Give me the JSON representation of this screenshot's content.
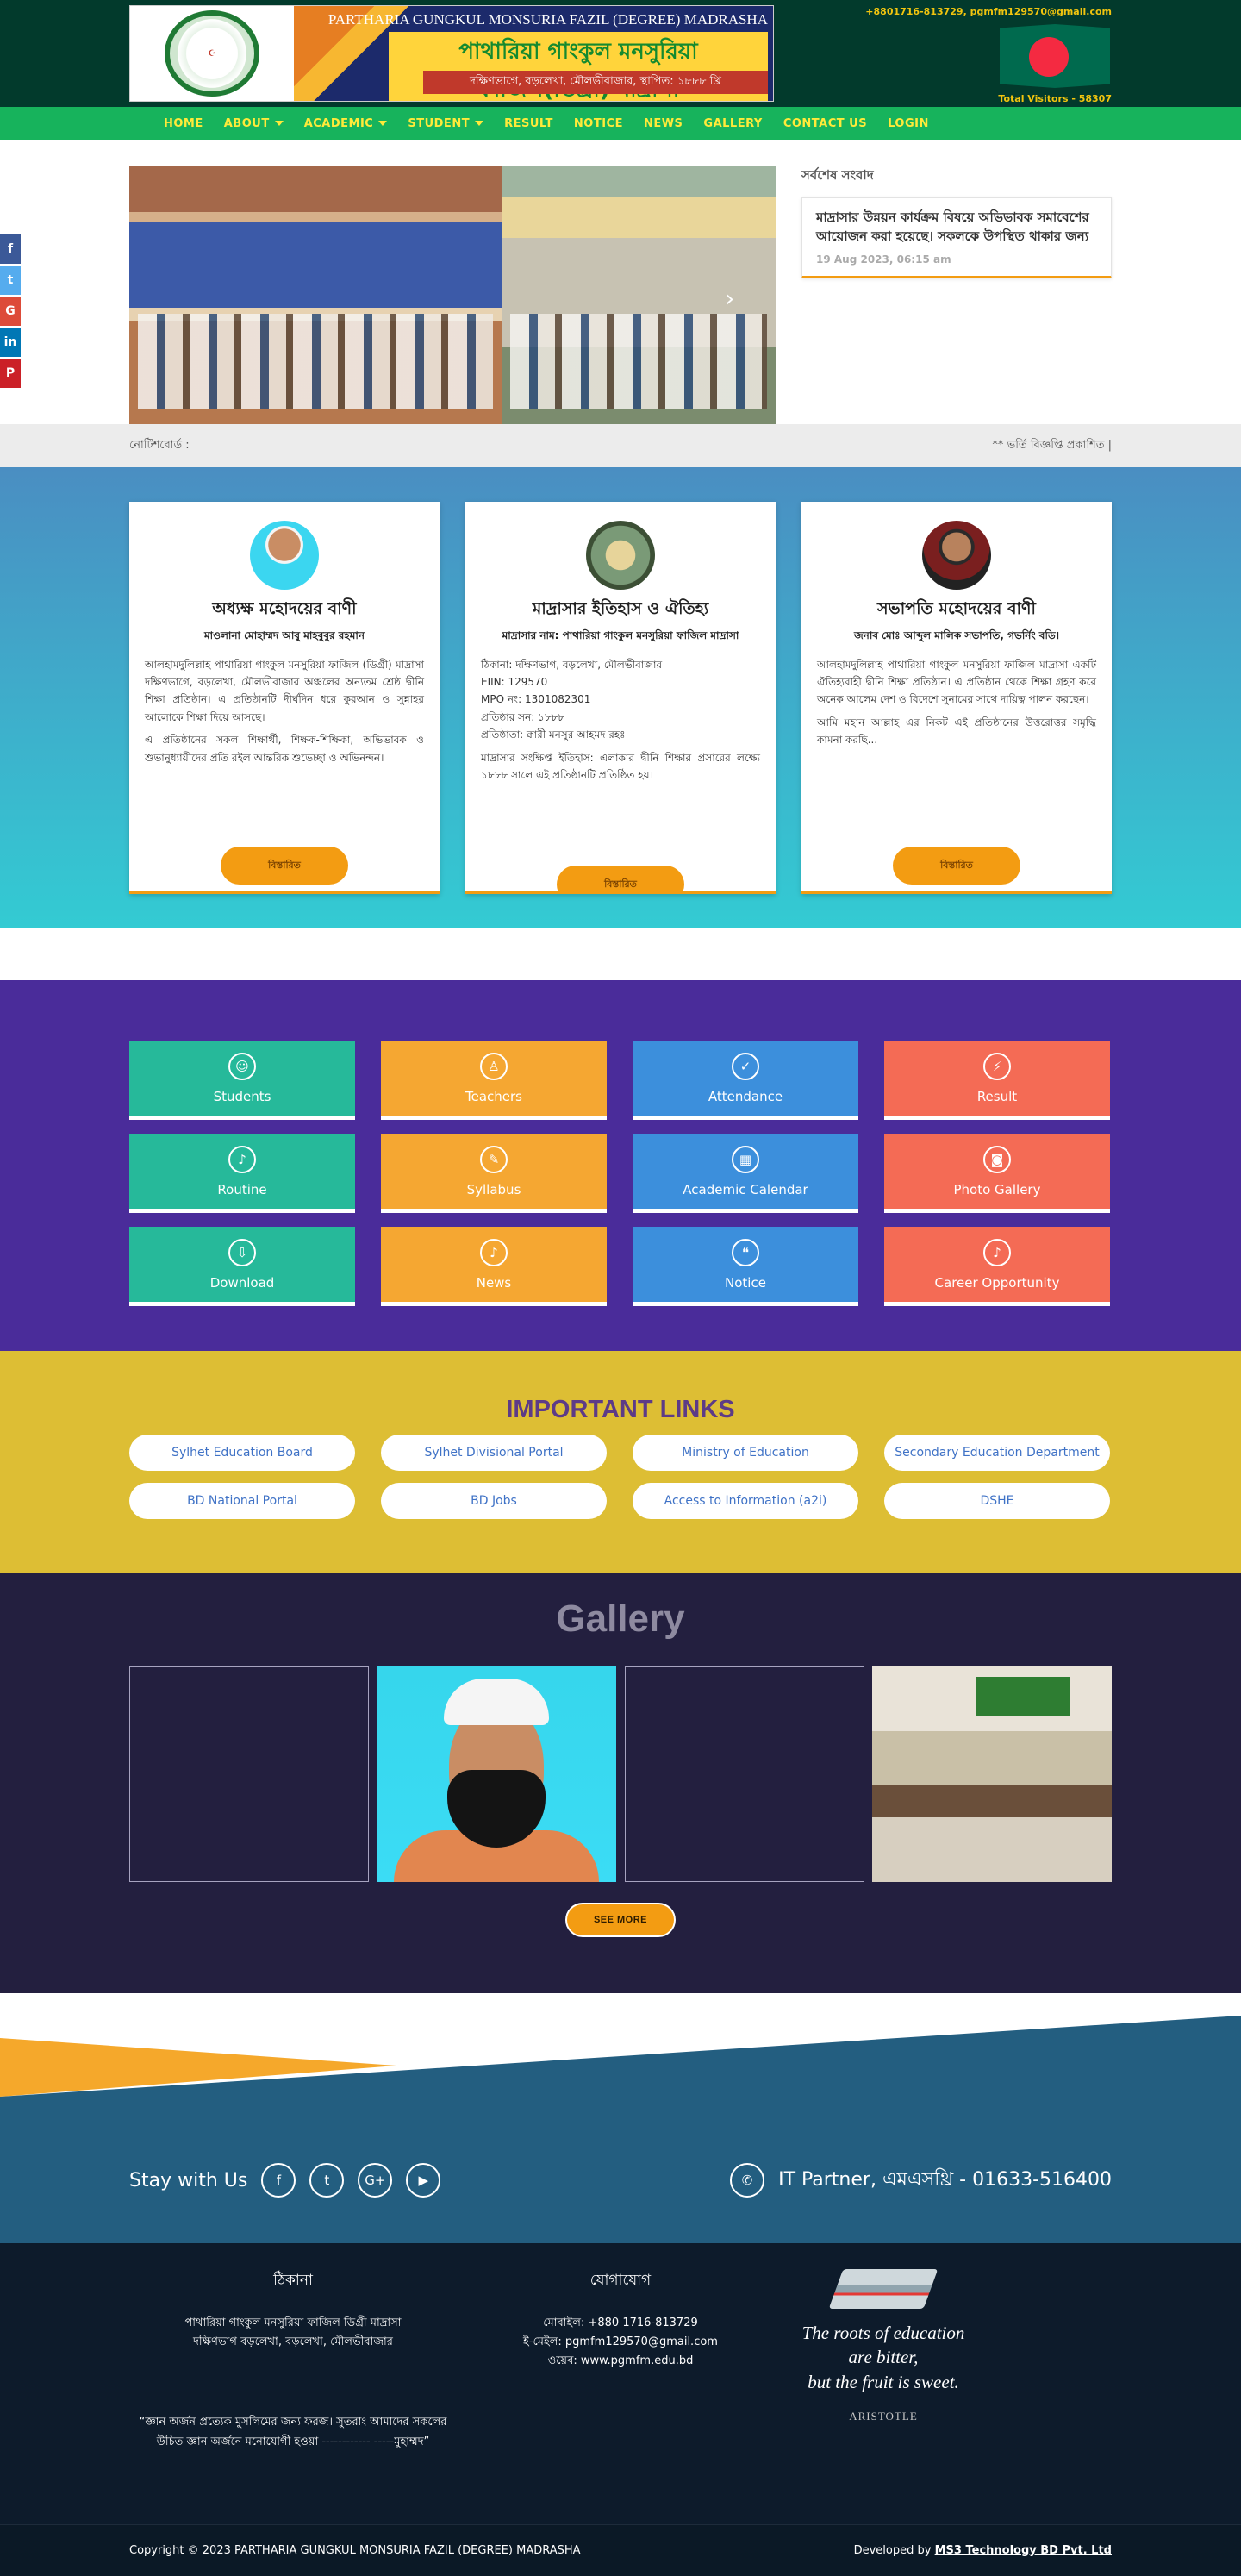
{
  "header": {
    "school_name_en": "PARTHARIA GUNGKUL MONSURIA FAZIL (DEGREE) MADRASHA",
    "school_name_bn": "পাথারিয়া গাংকুল মনসুরিয়া ফাজিল(ডিগ্রী) মাদ্রাসা",
    "address_bn": "দক্ষিণভাগে, বড়লেখা, মৌলভীবাজার, স্থাপিত: ১৮৮৮ খ্রি",
    "contact": "+8801716-813729, pgmfm129570@gmail.com",
    "visitors": "Total Visitors - 58307",
    "colors": {
      "header_bg": "#023a2c",
      "nav_bg": "#17b35c",
      "nav_text": "#ffea3a"
    }
  },
  "nav": [
    {
      "label": "HOME",
      "dropdown": false
    },
    {
      "label": "ABOUT",
      "dropdown": true
    },
    {
      "label": "ACADEMIC",
      "dropdown": true
    },
    {
      "label": "STUDENT",
      "dropdown": true
    },
    {
      "label": "RESULT",
      "dropdown": false
    },
    {
      "label": "NOTICE",
      "dropdown": false
    },
    {
      "label": "NEWS",
      "dropdown": false
    },
    {
      "label": "GALLERY",
      "dropdown": false
    },
    {
      "label": "CONTACT US",
      "dropdown": false
    },
    {
      "label": "LOGIN",
      "dropdown": false
    }
  ],
  "social_float": [
    "f",
    "t",
    "G",
    "in",
    "P"
  ],
  "latest_news": {
    "heading": "সর্বশেষ সংবাদ",
    "text": "মাদ্রাসার উন্নয়ন কার্যক্রম বিষয়ে অভিভাবক সমাবেশের আয়োজন করা হয়েছে। সকলকে উপস্থিত থাকার জন্য",
    "date": "19 Aug 2023, 06:15 am"
  },
  "ticker": {
    "label": "নোটিশবোর্ড :",
    "text": "** ভর্তি বিজ্ঞপ্তি প্রকাশিত |"
  },
  "profiles": [
    {
      "title": "অধ্যক্ষ মহোদয়ের বাণী",
      "subtitle": "মাওলানা মোহাম্মদ আবু মাহবুবুর রহমান",
      "body1": "আলহামদুলিল্লাহ পাথারিয়া গাংকুল মনসুরিয়া ফাজিল (ডিগ্রী) মাদ্রাসা দক্ষিণভাগে, বড়লেখা, মৌলভীবাজার অঞ্চলের অন্যতম শ্রেষ্ঠ দ্বীনি শিক্ষা প্রতিষ্ঠান। এ প্রতিষ্ঠানটি দীর্ঘদিন ধরে কুরআন ও সুন্নাহর আলোকে শিক্ষা দিয়ে আসছে।",
      "body2": "এ প্রতিষ্ঠানের সকল শিক্ষার্থী, শিক্ষক-শিক্ষিকা, অভিভাবক ও শুভানুধ্যায়ীদের প্রতি রইল আন্তরিক শুভেচ্ছা ও অভিনন্দন।",
      "button": "বিস্তারিত"
    },
    {
      "title": "মাদ্রাসার ইতিহাস ও ঐতিহ্য",
      "subtitle": "মাদ্রাসার নাম: পাথারিয়া গাংকুল মনসুরিয়া ফাজিল মাদ্রাসা",
      "lines": [
        "ঠিকানা: দক্ষিণভাগ, বড়লেখা, মৌলভীবাজার",
        "EIIN: 129570",
        "MPO নং: 1301082301",
        "প্রতিষ্ঠার সন: ১৮৮৮",
        "প্রতিষ্ঠাতা: ক্বারী মনসুর আহমদ রহঃ"
      ],
      "body2": "মাদ্রাসার সংক্ষিপ্ত ইতিহাস: এলাকার দ্বীনি শিক্ষার প্রসারের লক্ষ্যে ১৮৮৮ সালে এই প্রতিষ্ঠানটি প্রতিষ্ঠিত হয়।",
      "button": "বিস্তারিত"
    },
    {
      "title": "সভাপতি মহোদয়ের বাণী",
      "subtitle": "জনাব মোঃ আব্দুল মালিক সভাপতি, গভর্নিং বডি।",
      "body1": "আলহামদুলিল্লাহ পাথারিয়া গাংকুল মনসুরিয়া ফাজিল মাদ্রাসা একটি ঐতিহ্যবাহী দ্বীনি শিক্ষা প্রতিষ্ঠান। এ প্রতিষ্ঠান থেকে শিক্ষা গ্রহণ করে অনেক আলেম দেশ ও বিদেশে সুনামের সাথে দায়িত্ব পালন করছেন।",
      "body2": "আমি মহান আল্লাহ এর নিকট এই প্রতিষ্ঠানের উত্তরোত্তর সমৃদ্ধি কামনা করছি...",
      "button": "বিস্তারিত"
    }
  ],
  "quick_links": [
    {
      "label": "Students",
      "icon": "students-icon",
      "glyph": "☺",
      "color": "green"
    },
    {
      "label": "Teachers",
      "icon": "teachers-icon",
      "glyph": "♙",
      "color": "orange"
    },
    {
      "label": "Attendance",
      "icon": "check-icon",
      "glyph": "✓",
      "color": "blue"
    },
    {
      "label": "Result",
      "icon": "bolt-icon",
      "glyph": "⚡",
      "color": "red"
    },
    {
      "label": "Routine",
      "icon": "bell-icon",
      "glyph": "♪",
      "color": "green"
    },
    {
      "label": "Syllabus",
      "icon": "compass-icon",
      "glyph": "✎",
      "color": "orange"
    },
    {
      "label": "Academic Calendar",
      "icon": "calendar-icon",
      "glyph": "▦",
      "color": "blue"
    },
    {
      "label": "Photo Gallery",
      "icon": "camera-icon",
      "glyph": "◙",
      "color": "red"
    },
    {
      "label": "Download",
      "icon": "download-icon",
      "glyph": "⇩",
      "color": "green"
    },
    {
      "label": "News",
      "icon": "bell-icon",
      "glyph": "♪",
      "color": "orange"
    },
    {
      "label": "Notice",
      "icon": "quote-icon",
      "glyph": "❝",
      "color": "blue"
    },
    {
      "label": "Career Opportunity",
      "icon": "bell-icon",
      "glyph": "♪",
      "color": "red"
    }
  ],
  "important_links": {
    "heading": "IMPORTANT LINKS",
    "items": [
      "Sylhet Education Board",
      "Sylhet Divisional Portal",
      "Ministry of Education",
      "Secondary Education Department",
      "BD National Portal",
      "BD Jobs",
      "Access to Information (a2i)",
      "DSHE"
    ]
  },
  "gallery": {
    "heading": "Gallery",
    "button": "SEE MORE"
  },
  "stay": {
    "label": "Stay with Us",
    "icons": [
      {
        "name": "facebook-icon",
        "glyph": "f"
      },
      {
        "name": "twitter-icon",
        "glyph": "t"
      },
      {
        "name": "google-plus-icon",
        "glyph": "G+"
      },
      {
        "name": "youtube-icon",
        "glyph": "▶"
      }
    ],
    "it_partner": "IT Partner, এমএসথ্রি - 01633-516400"
  },
  "footer": {
    "address_heading": "ঠিকানা",
    "address_line1": "পাথারিয়া গাংকুল মনসুরিয়া ফাজিল ডিগ্রী মাদ্রাসা",
    "address_line2": "দক্ষিণভাগ বড়লেখা, বড়লেখা, মৌলভীবাজার",
    "contact_heading": "যোগাযোগ",
    "phone": "মোবাইল: +880 1716-813729",
    "email": "ই-মেইল: pgmfm129570@gmail.com",
    "web": "ওয়েব: www.pgmfm.edu.bd",
    "quote": "“জ্ঞান অর্জন প্রত্যেক মুসলিমের জন্য ফরজ। সুতরাং আমাদের সকলের উচিত জ্ঞান অর্জনে মনোযোগী হওয়া ------------ -----মুহাম্মদ”",
    "aristotle_line1": "The roots of education",
    "aristotle_line2": "are bitter,",
    "aristotle_line3": "but the fruit is sweet.",
    "aristotle_name": "ARISTOTLE"
  },
  "copyright": {
    "text": "Copyright © 2023 PARTHARIA GUNGKUL MONSURIA FAZIL (DEGREE) MADRASHA",
    "developed_prefix": "Developed by",
    "developer": "MS3 Technology BD Pvt. Ltd"
  }
}
